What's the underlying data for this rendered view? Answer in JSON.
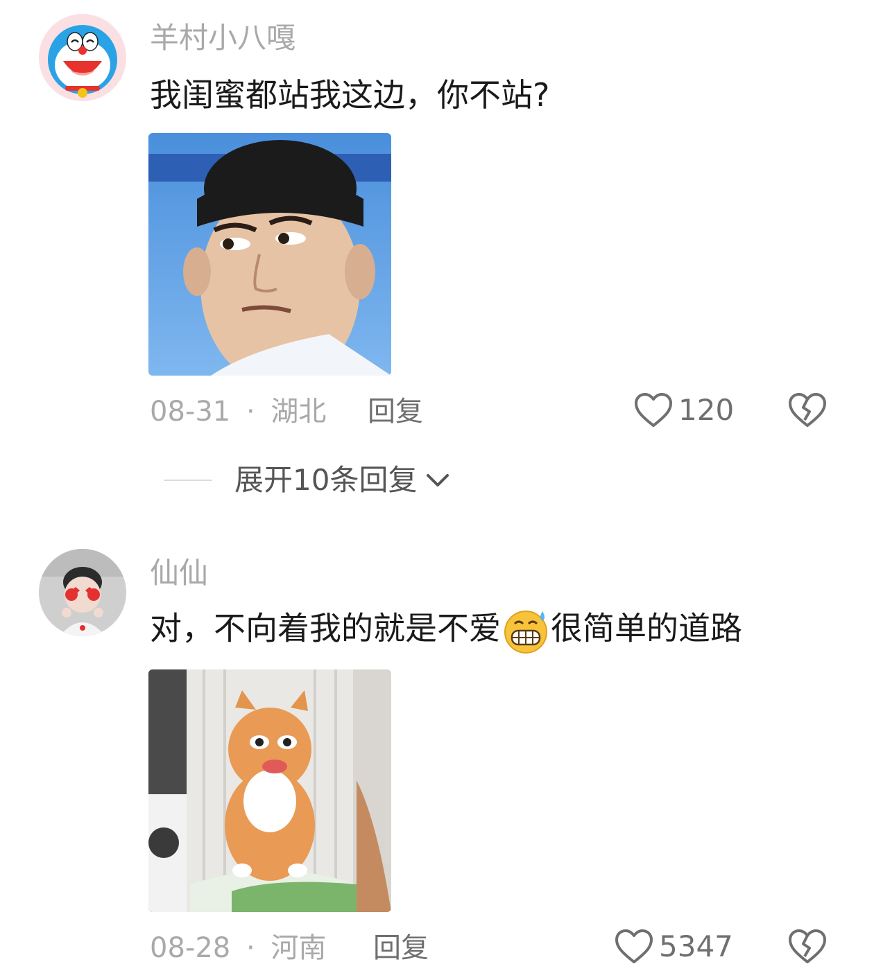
{
  "comments": [
    {
      "username": "羊村小八嘎",
      "text": "我闺蜜都站我这边，你不站?",
      "date": "08-31",
      "location": "湖北",
      "reply_label": "回复",
      "likes": "120",
      "avatar_icon": "doraemon-avatar"
    },
    {
      "username": "仙仙",
      "text_before": "对，不向着我的就是不爱",
      "emoji": "grinning-sweat-emoji",
      "text_after": "很简单的道路",
      "date": "08-28",
      "location": "河南",
      "reply_label": "回复",
      "likes": "5347",
      "avatar_icon": "girl-hearts-avatar"
    }
  ],
  "expand_replies": {
    "label": "展开10条回复"
  },
  "separator": "·"
}
